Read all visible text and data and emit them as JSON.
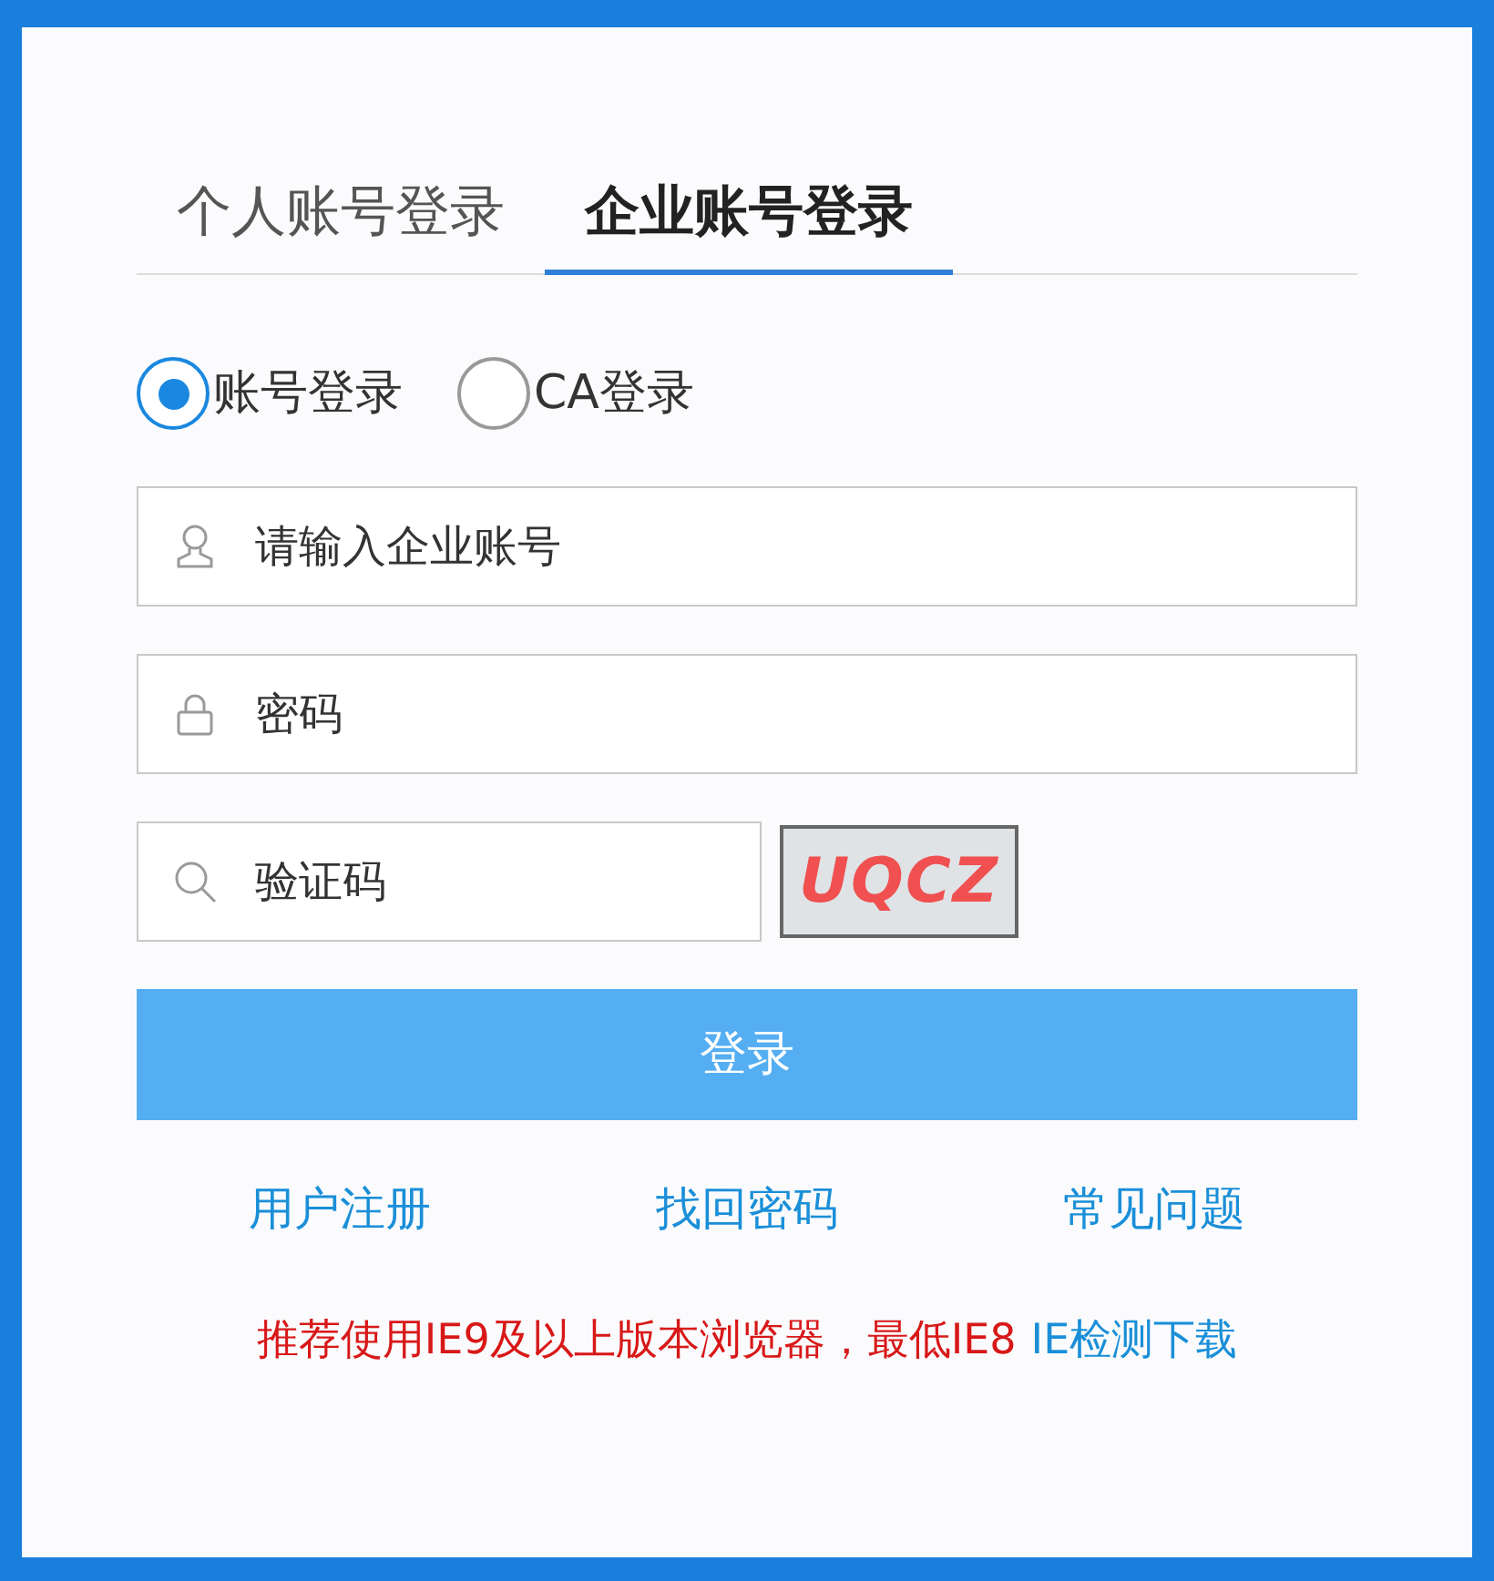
{
  "tabs": [
    {
      "label": "个人账号登录",
      "selected": false
    },
    {
      "label": "企业账号登录",
      "selected": true
    }
  ],
  "login_modes": [
    {
      "label": "账号登录",
      "selected": true
    },
    {
      "label": "CA登录",
      "selected": false
    }
  ],
  "fields": [
    {
      "kind": "user",
      "placeholder": "请输入企业账号"
    },
    {
      "kind": "lock",
      "placeholder": "密码"
    },
    {
      "kind": "search",
      "placeholder": "验证码"
    }
  ],
  "captcha": {
    "text": "UQCZ"
  },
  "login_button": "登录",
  "links": [
    "用户注册",
    "找回密码",
    "常见问题"
  ],
  "notice": {
    "text": "推荐使用IE9及以上版本浏览器，最低IE8",
    "link": "IE检测下载"
  }
}
